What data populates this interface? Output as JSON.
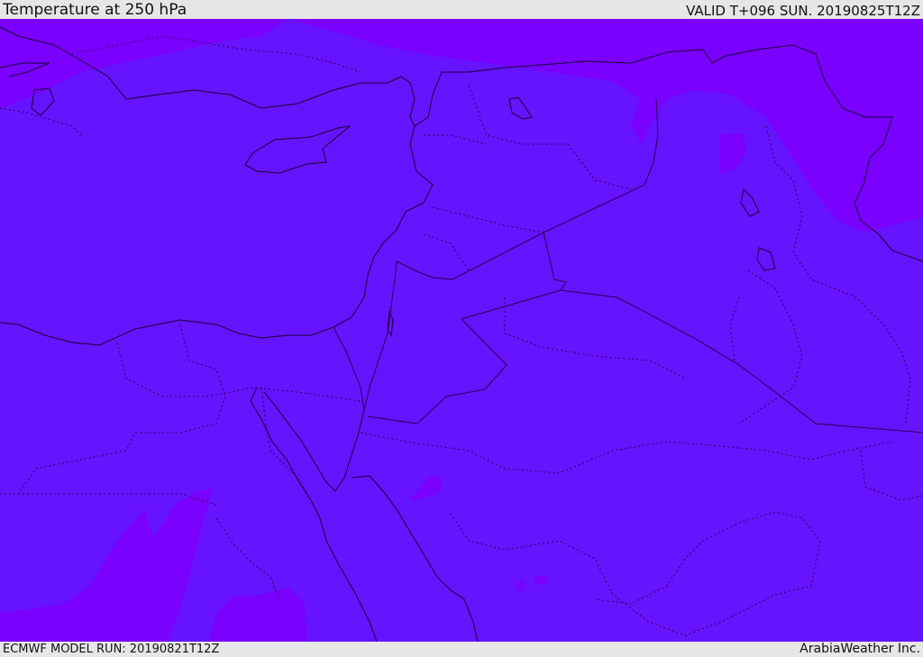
{
  "header": {
    "title": "Temperature at 250 hPa",
    "valid": "VALID T+096 SUN. 20190825T12Z"
  },
  "footer": {
    "model_run": "ECMWF MODEL RUN: 20190821T12Z",
    "credit": "ArabiaWeather Inc."
  },
  "map": {
    "colors": {
      "base_fill": "#6613ff",
      "warm_fill": "#7a00ff",
      "coastline": "#1a0033",
      "border": "#2a0050"
    }
  }
}
